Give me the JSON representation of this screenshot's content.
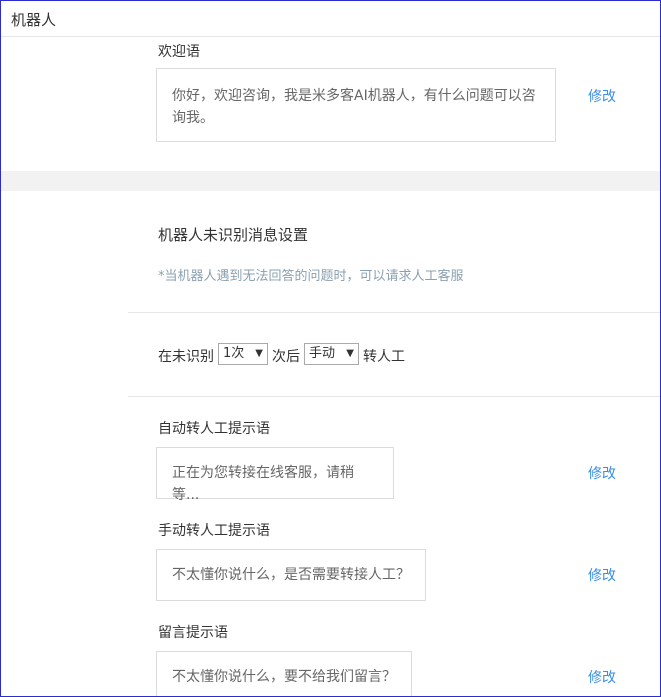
{
  "header": {
    "title": "机器人"
  },
  "welcome": {
    "label": "欢迎语",
    "text": "你好，欢迎咨询，我是米多客AI机器人，有什么问题可以咨询我。",
    "edit_label": "修改"
  },
  "unrecognized": {
    "title": "机器人未识别消息设置",
    "hint": "*当机器人遇到无法回答的问题时，可以请求人工客服",
    "rule": {
      "prefix": "在未识别",
      "count_value": "1次",
      "middle": "次后",
      "mode_value": "手动",
      "suffix": "转人工"
    }
  },
  "auto_prompt": {
    "label": "自动转人工提示语",
    "text": "正在为您转接在线客服，请稍等...",
    "edit_label": "修改"
  },
  "manual_prompt": {
    "label": "手动转人工提示语",
    "text": "不太懂你说什么，是否需要转接人工？",
    "edit_label": "修改"
  },
  "message_prompt": {
    "label": "留言提示语",
    "text": "不太懂你说什么，要不给我们留言？",
    "edit_label": "修改"
  },
  "icons": {
    "dropdown": "caret-down-icon"
  },
  "colors": {
    "link": "#3a8ee6",
    "hint": "#8aa0b2",
    "band": "#f2f2f2",
    "frame": "#2b2bd0"
  }
}
